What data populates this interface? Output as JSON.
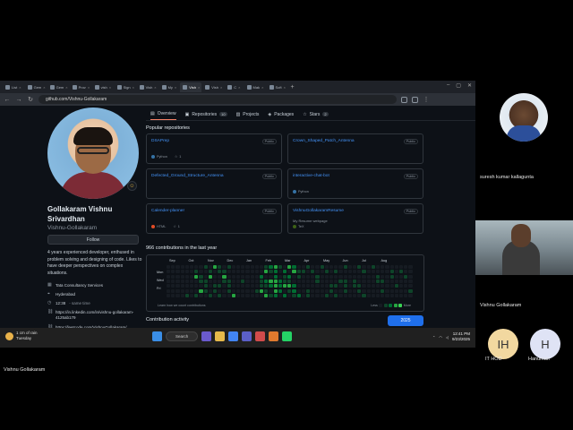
{
  "browser": {
    "tabs": [
      {
        "label": "List",
        "active": false
      },
      {
        "label": "Gem",
        "active": false
      },
      {
        "label": "Gem",
        "active": false
      },
      {
        "label": "Prov",
        "active": false
      },
      {
        "label": "vish",
        "active": false
      },
      {
        "label": "Sign",
        "active": false
      },
      {
        "label": "Vish",
        "active": false
      },
      {
        "label": "My",
        "active": false
      },
      {
        "label": "Vish",
        "active": true
      },
      {
        "label": "Vish",
        "active": false
      },
      {
        "label": "C",
        "active": false
      },
      {
        "label": "Mak",
        "active": false
      },
      {
        "label": "Soft",
        "active": false
      }
    ],
    "url": "github.com/Vishnu-Gollakaram"
  },
  "profile": {
    "fullname": "Gollakaram Vishnu Srivardhan",
    "username": "Vishnu-Gollakaram",
    "follow_label": "Follow",
    "bio": "4 years experienced developer, enthused in problem solving and designing of code. Likes to have deeper perspectives on complex situations.",
    "company": "Tata Consultancy Services",
    "location": "Hyderabad",
    "time": "12:38",
    "time_note": "- same time",
    "linkedin": "https://in.linkedin.com/in/vishnu-gollakaram-4125ab179",
    "leetcode": "https://leetcode.com/VishnuGollakaram/"
  },
  "profile_nav": {
    "overview": "Overview",
    "repositories": "Repositories",
    "repositories_count": "10",
    "projects": "Projects",
    "packages": "Packages",
    "stars": "Stars",
    "stars_count": "2"
  },
  "popular": {
    "title": "Popular repositories",
    "repos": [
      {
        "name": "DSAPrep",
        "badge": "Public",
        "desc": "",
        "lang": "Python",
        "lang_color": "#3572A5",
        "stars": "1"
      },
      {
        "name": "Crown_Shaped_Patch_Antenna",
        "badge": "Public",
        "desc": "",
        "lang": "",
        "lang_color": "",
        "stars": ""
      },
      {
        "name": "Defected_Ground_Structure_Antenna",
        "badge": "Public",
        "desc": "",
        "lang": "",
        "lang_color": "",
        "stars": ""
      },
      {
        "name": "interactive-chat-bot",
        "badge": "Public",
        "desc": "",
        "lang": "Python",
        "lang_color": "#3572A5",
        "stars": ""
      },
      {
        "name": "Calender-planner",
        "badge": "Public",
        "desc": "",
        "lang": "HTML",
        "lang_color": "#e34c26",
        "stars": "1"
      },
      {
        "name": "VishnuGollakaramResume",
        "badge": "Public",
        "desc": "My Resume webpage",
        "lang": "TeX",
        "lang_color": "#3D6117",
        "stars": ""
      }
    ]
  },
  "contributions": {
    "title": "966 contributions in the last year",
    "months": [
      "Sep",
      "Oct",
      "Nov",
      "Dec",
      "Jan",
      "Feb",
      "Mar",
      "Apr",
      "May",
      "Jun",
      "Jul",
      "Aug"
    ],
    "days": [
      "Mon",
      "Wed",
      "Fri"
    ],
    "learn": "Learn how we count contributions",
    "less": "Less",
    "more": "More",
    "levels": [
      "#161b22",
      "#0e4429",
      "#006d32",
      "#26a641",
      "#39d353"
    ]
  },
  "activity": {
    "title": "Contribution activity",
    "year": "2025"
  },
  "taskbar": {
    "weather_temp": "1 cm of rain",
    "weather_day": "Tuesday",
    "search": "Search",
    "time": "12:41 PM",
    "date": "9/23/2025"
  },
  "meeting": {
    "participant1": "suresh kumar kallagunta",
    "participant2": "Vishnu Gollakaram",
    "participant3_initials": "IH",
    "participant3": "IT HOD",
    "participant4_initials": "H",
    "participant4": "Hanuman",
    "presenter": "Vishnu Gollakaram"
  }
}
